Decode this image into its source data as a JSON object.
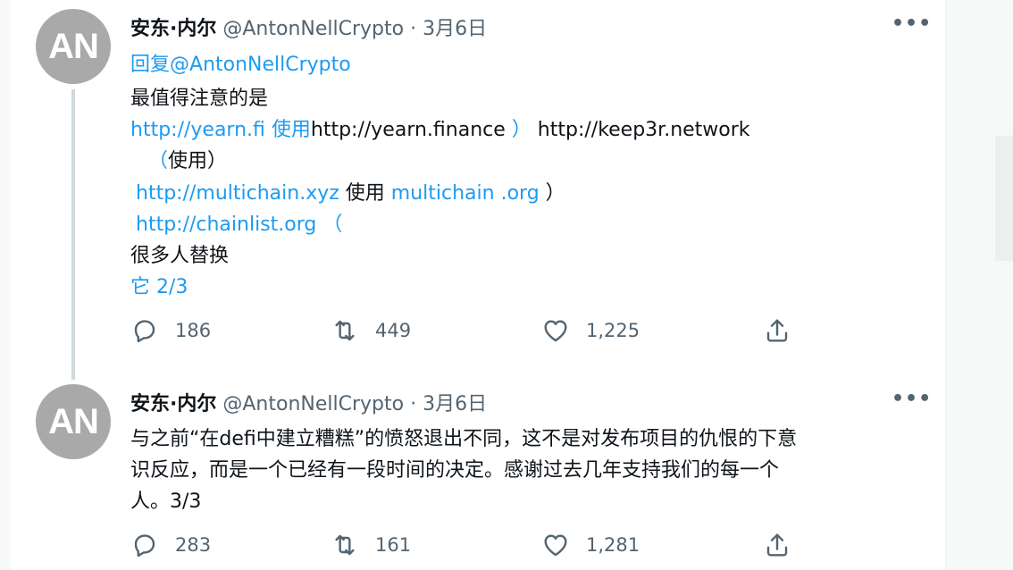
{
  "tweets": [
    {
      "avatar_initials": "AN",
      "name": "安东·内尔",
      "handle": "@AntonNellCrypto",
      "dot": "·",
      "date": "3月6日",
      "more": "•••",
      "reply_prefix": "回复",
      "reply_handle": "@AntonNellCrypto",
      "body": {
        "l1": "最值得注意的是",
        "l2_a": "http://yearn.fi 使用",
        "l2_b": "http://yearn.finance",
        "l2_c": "）",
        "l2_d": "http://keep3r.network",
        "l3_a": "（",
        "l3_b": "使用）",
        "l4_a": "http://multichain.xyz",
        "l4_b": "使用",
        "l4_c": "multichain .org",
        "l4_d": "）",
        "l5": "http://chainlist.org （",
        "l6": "很多人替换",
        "l7": "它 2/3"
      },
      "stats": {
        "replies": "186",
        "retweets": "449",
        "likes": "1,225"
      }
    },
    {
      "avatar_initials": "AN",
      "name": "安东·内尔",
      "handle": "@AntonNellCrypto",
      "dot": "·",
      "date": "3月6日",
      "more": "•••",
      "body": {
        "l1": "与之前“在defi中建立糟糕”的愤怒退出不同，这不是对发布项目的仇恨的下意",
        "l2": "识反应，而是一个已经有一段时间的决定。感谢过去几年支持我们的每一个",
        "l3": "人。3/3"
      },
      "stats": {
        "replies": "283",
        "retweets": "161",
        "likes": "1,281"
      }
    }
  ],
  "icons": {
    "reply": "reply-icon",
    "retweet": "retweet-icon",
    "like": "heart-icon",
    "share": "share-icon"
  },
  "colors": {
    "link": "#1d9bf0",
    "secondary": "#536471",
    "text": "#0f1419"
  }
}
